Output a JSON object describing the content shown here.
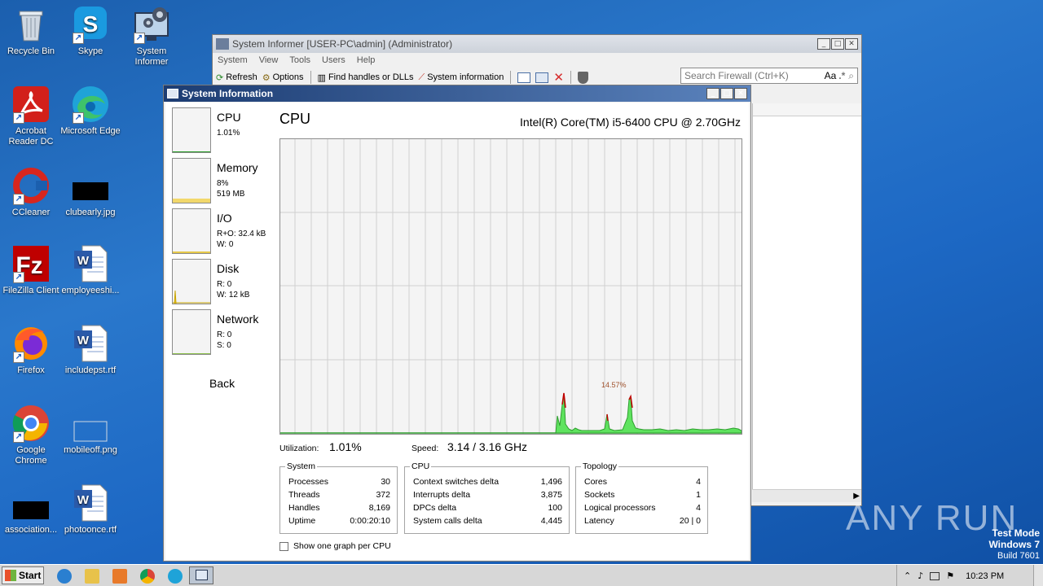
{
  "desktop": {
    "icons": [
      {
        "label": "Recycle Bin",
        "icon": "recycle-bin-icon"
      },
      {
        "label": "Skype",
        "icon": "skype-icon"
      },
      {
        "label": "System Informer",
        "icon": "system-informer-icon"
      },
      {
        "label": "Acrobat Reader DC",
        "icon": "acrobat-icon"
      },
      {
        "label": "Microsoft Edge",
        "icon": "edge-icon"
      },
      {
        "label": "CCleaner",
        "icon": "ccleaner-icon"
      },
      {
        "label": "clubearly.jpg",
        "icon": "image-file-icon"
      },
      {
        "label": "FileZilla Client",
        "icon": "filezilla-icon"
      },
      {
        "label": "employeeshi...",
        "icon": "word-doc-icon"
      },
      {
        "label": "Firefox",
        "icon": "firefox-icon"
      },
      {
        "label": "includepst.rtf",
        "icon": "word-doc-icon"
      },
      {
        "label": "Google Chrome",
        "icon": "chrome-icon"
      },
      {
        "label": "mobileoff.png",
        "icon": "image-file-icon"
      },
      {
        "label": "association...",
        "icon": "image-file-icon"
      },
      {
        "label": "photoonce.rtf",
        "icon": "word-doc-icon"
      }
    ]
  },
  "main_window": {
    "title": "System Informer [USER-PC\\admin] (Administrator)",
    "menu": [
      "System",
      "View",
      "Tools",
      "Users",
      "Help"
    ],
    "toolbar": {
      "refresh": "Refresh",
      "options": "Options",
      "find": "Find handles or DLLs",
      "sysinfo": "System information"
    },
    "search_placeholder": "Search Firewall (Ctrl+K)",
    "search_aa": "Aa"
  },
  "sysinfo_window": {
    "title": "System Information",
    "sidebar": {
      "cpu": {
        "name": "CPU",
        "v1": "1.01%"
      },
      "memory": {
        "name": "Memory",
        "v1": "8%",
        "v2": "519 MB"
      },
      "io": {
        "name": "I/O",
        "v1": "R+O: 32.4 kB",
        "v2": "W: 0"
      },
      "disk": {
        "name": "Disk",
        "v1": "R: 0",
        "v2": "W: 12 kB"
      },
      "network": {
        "name": "Network",
        "v1": "R: 0",
        "v2": "S: 0"
      },
      "back": "Back"
    },
    "heading": "CPU",
    "cpu_name": "Intel(R) Core(TM) i5-6400 CPU @ 2.70GHz",
    "peak_label": "14.57%",
    "utilization_label": "Utilization:",
    "utilization_value": "1.01%",
    "speed_label": "Speed:",
    "speed_value": "3.14 / 3.16 GHz",
    "system_box": {
      "title": "System",
      "rows": [
        [
          "Processes",
          "30"
        ],
        [
          "Threads",
          "372"
        ],
        [
          "Handles",
          "8,169"
        ],
        [
          "Uptime",
          "0:00:20:10"
        ]
      ]
    },
    "cpu_box": {
      "title": "CPU",
      "rows": [
        [
          "Context switches delta",
          "1,496"
        ],
        [
          "Interrupts delta",
          "3,875"
        ],
        [
          "DPCs delta",
          "100"
        ],
        [
          "System calls delta",
          "4,445"
        ]
      ]
    },
    "topology_box": {
      "title": "Topology",
      "rows": [
        [
          "Cores",
          "4"
        ],
        [
          "Sockets",
          "1"
        ],
        [
          "Logical processors",
          "4"
        ],
        [
          "Latency",
          "20 | 0"
        ]
      ]
    },
    "checkbox_label": "Show one graph per CPU"
  },
  "taskbar": {
    "start": "Start",
    "time": "10:23 PM"
  },
  "watermark": {
    "brand": "ANY RUN",
    "line1": "Test Mode",
    "line2": "Windows 7",
    "line3": "Build 7601"
  },
  "colors": {
    "cpu_fill": "#5fe35f",
    "cpu_peak": "#c00000",
    "memory_line": "#e6c84a",
    "title_active": "#1c3c72"
  }
}
